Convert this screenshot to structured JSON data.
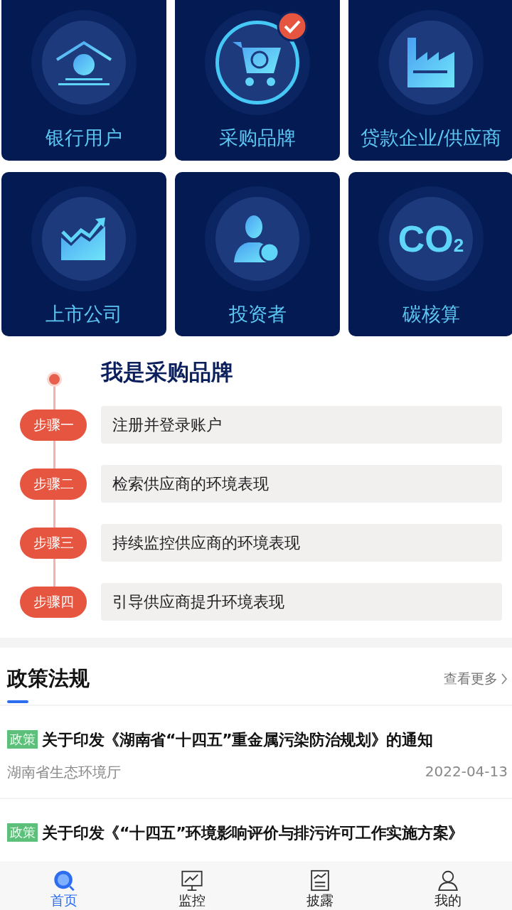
{
  "roles": [
    {
      "kind": "bank",
      "label": "银行用户",
      "selected": false
    },
    {
      "kind": "cart",
      "label": "采购品牌",
      "selected": true
    },
    {
      "kind": "factory",
      "label": "贷款企业/供应商",
      "selected": false
    },
    {
      "kind": "chart",
      "label": "上市公司",
      "selected": false
    },
    {
      "kind": "investor",
      "label": "投资者",
      "selected": false
    },
    {
      "kind": "co2",
      "label": "碳核算",
      "selected": false,
      "icon_text": "CO$_{2}$"
    }
  ],
  "guide": {
    "title": "我是采购品牌",
    "steps": [
      {
        "badge": "步骤一",
        "text": "注册并登录账户"
      },
      {
        "badge": "步骤二",
        "text": "检索供应商的环境表现"
      },
      {
        "badge": "步骤三",
        "text": "持续监控供应商的环境表现"
      },
      {
        "badge": "步骤四",
        "text": "引导供应商提升环境表现"
      }
    ]
  },
  "policy": {
    "title": "政策法规",
    "more": "查看更多",
    "items": [
      {
        "tag": "政策",
        "title": "关于印发《湖南省“十四五”重金属污染防治规划》的通知",
        "source": "湖南省生态环境厅",
        "date": "2022-04-13"
      },
      {
        "tag": "政策",
        "title": "关于印发《“十四五”环境影响评价与排污许可工作实施方案》"
      }
    ]
  },
  "tabs": [
    {
      "kind": "home",
      "label": "首页",
      "selected": true
    },
    {
      "kind": "monitor",
      "label": "监控",
      "selected": false
    },
    {
      "kind": "disclose",
      "label": "披露",
      "selected": false
    },
    {
      "kind": "me",
      "label": "我的",
      "selected": false
    }
  ]
}
